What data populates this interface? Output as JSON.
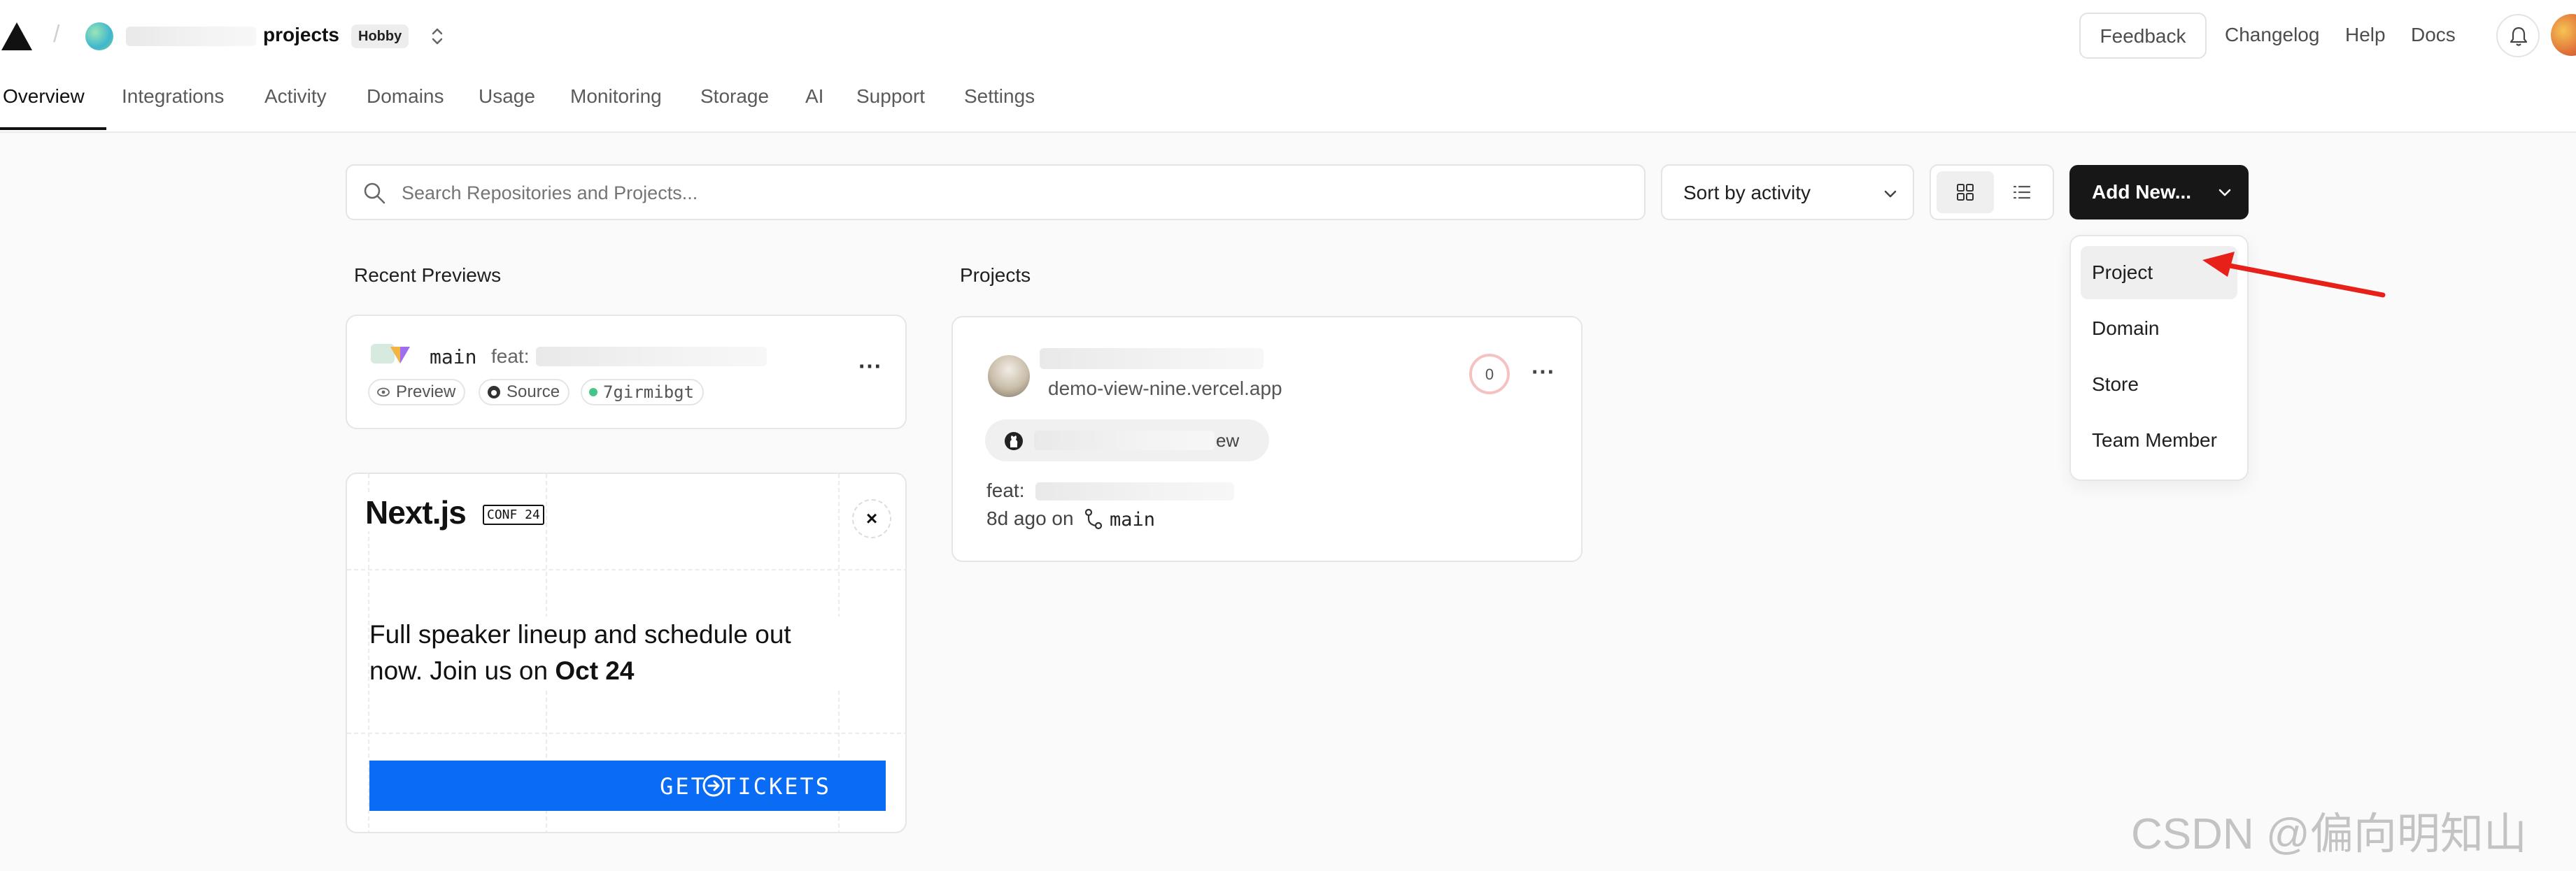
{
  "header": {
    "team_suffix": "projects",
    "plan_badge": "Hobby",
    "links": {
      "feedback": "Feedback",
      "changelog": "Changelog",
      "help": "Help",
      "docs": "Docs"
    }
  },
  "tabs": [
    {
      "label": "Overview"
    },
    {
      "label": "Integrations"
    },
    {
      "label": "Activity"
    },
    {
      "label": "Domains"
    },
    {
      "label": "Usage"
    },
    {
      "label": "Monitoring"
    },
    {
      "label": "Storage"
    },
    {
      "label": "AI"
    },
    {
      "label": "Support"
    },
    {
      "label": "Settings"
    }
  ],
  "active_tab": "Overview",
  "toolbar": {
    "search_placeholder": "Search Repositories and Projects...",
    "sort_label": "Sort by activity",
    "add_new_label": "Add New..."
  },
  "dropdown": {
    "items": [
      {
        "label": "Project"
      },
      {
        "label": "Domain"
      },
      {
        "label": "Store"
      },
      {
        "label": "Team Member"
      }
    ]
  },
  "recent_previews": {
    "title": "Recent Previews",
    "item": {
      "branch": "main",
      "commit_prefix": "feat:",
      "preview_label": "Preview",
      "source_label": "Source",
      "commit_hash": "7girmibgt"
    }
  },
  "promo": {
    "logo_text": "Next.js",
    "logo_badge": "CONF 24",
    "text_line1": "Full speaker lineup and schedule out",
    "text_line2_prefix": "now. Join us on ",
    "text_line2_date": "Oct 24",
    "cta_label": "GET TICKETS",
    "close_symbol": "×"
  },
  "projects": {
    "title": "Projects",
    "card": {
      "domain": "demo-view-nine.vercel.app",
      "repo_suffix": "ew",
      "commit_prefix": "feat:",
      "time_text": "8d ago on",
      "branch": "main",
      "score": "0"
    }
  },
  "watermark": "CSDN @偏向明知山",
  "colors": {
    "accent_blue": "#0a6cf5",
    "primary_dark": "#171717",
    "annotation_red": "#e8201a",
    "score_ring": "#f5c2c2"
  }
}
